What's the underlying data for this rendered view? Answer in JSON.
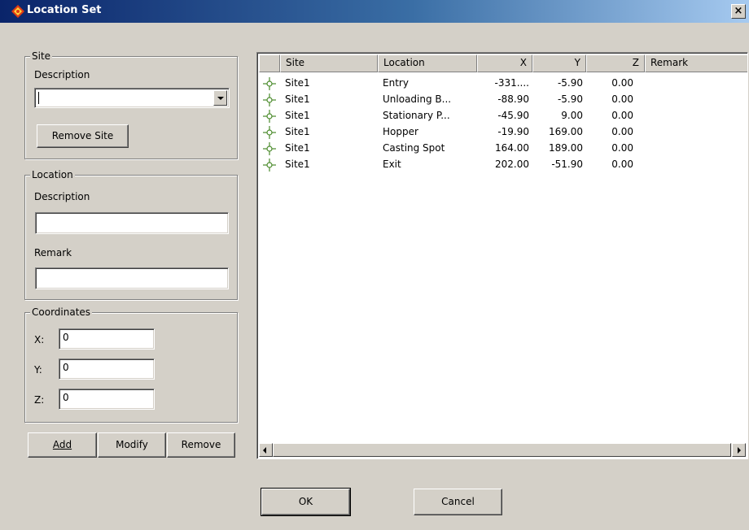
{
  "window": {
    "title": "Location Set"
  },
  "site_group": {
    "label": "Site",
    "description_label": "Description",
    "description_value": "",
    "remove_site_label": "Remove Site"
  },
  "location_group": {
    "label": "Location",
    "description_label": "Description",
    "description_value": "",
    "remark_label": "Remark",
    "remark_value": ""
  },
  "coordinates_group": {
    "label": "Coordinates",
    "x_label": "X:",
    "x_value": "0",
    "y_label": "Y:",
    "y_value": "0",
    "z_label": "Z:",
    "z_value": "0"
  },
  "actions": {
    "add": "Add",
    "modify": "Modify",
    "remove": "Remove"
  },
  "table": {
    "columns": [
      "Site",
      "Location",
      "X",
      "Y",
      "Z",
      "Remark"
    ],
    "rows": [
      {
        "site": "Site1",
        "location": "Entry",
        "x": "-331....",
        "y": "-5.90",
        "z": "0.00",
        "remark": ""
      },
      {
        "site": "Site1",
        "location": "Unloading B...",
        "x": "-88.90",
        "y": "-5.90",
        "z": "0.00",
        "remark": ""
      },
      {
        "site": "Site1",
        "location": "Stationary P...",
        "x": "-45.90",
        "y": "9.00",
        "z": "0.00",
        "remark": ""
      },
      {
        "site": "Site1",
        "location": "Hopper",
        "x": "-19.90",
        "y": "169.00",
        "z": "0.00",
        "remark": ""
      },
      {
        "site": "Site1",
        "location": "Casting Spot",
        "x": "164.00",
        "y": "189.00",
        "z": "0.00",
        "remark": ""
      },
      {
        "site": "Site1",
        "location": "Exit",
        "x": "202.00",
        "y": "-51.90",
        "z": "0.00",
        "remark": ""
      }
    ]
  },
  "footer": {
    "ok": "OK",
    "cancel": "Cancel"
  },
  "icons": {
    "app": "app-logo-icon",
    "row": "location-point-icon",
    "close": "close-icon"
  },
  "colors": {
    "titlebar_start": "#0a246a",
    "titlebar_end": "#a6caf0",
    "face": "#d4d0c8",
    "logo": "#e03c14",
    "row_icon": "#4a8a2a"
  }
}
